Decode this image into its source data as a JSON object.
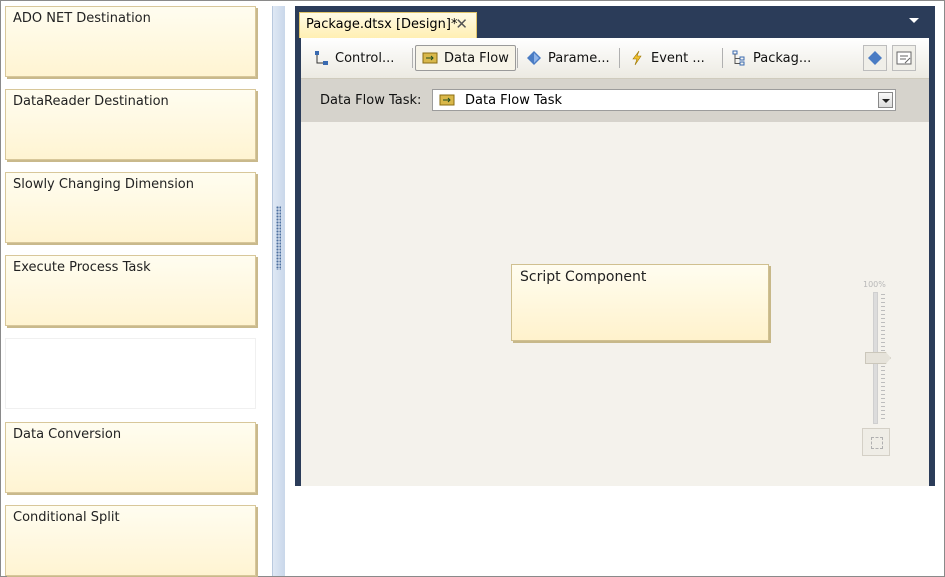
{
  "choices": [
    {
      "label": "ADO NET Destination"
    },
    {
      "label": "DataReader Destination"
    },
    {
      "label": "Slowly Changing Dimension"
    },
    {
      "label": "Execute Process Task"
    },
    {
      "label": ""
    },
    {
      "label": "Data Conversion"
    },
    {
      "label": "Conditional Split"
    }
  ],
  "designer": {
    "doc_tab": "Package.dtsx [Design]*",
    "tabs": [
      {
        "label": "Control...",
        "icon": "control-flow-icon"
      },
      {
        "label": "Data Flow",
        "icon": "data-flow-icon"
      },
      {
        "label": "Parame...",
        "icon": "parameters-icon"
      },
      {
        "label": "Event ...",
        "icon": "event-handlers-icon"
      },
      {
        "label": "Packag...",
        "icon": "package-explorer-icon"
      }
    ],
    "task_label": "Data Flow Task:",
    "task_value": "Data Flow Task",
    "component": "Script Component",
    "zoom": "100%"
  }
}
